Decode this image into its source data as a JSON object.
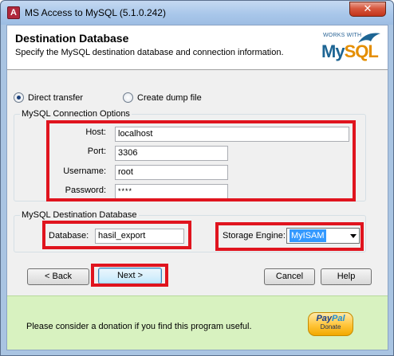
{
  "window": {
    "title": "MS Access to MySQL (5.1.0.242)",
    "close_glyph": "✕"
  },
  "header": {
    "title": "Destination Database",
    "subtitle": "Specify the MySQL destination database and connection information.",
    "logo": {
      "works_with": "WORKS WITH",
      "my": "My",
      "sql": "SQL"
    }
  },
  "transfer_mode": {
    "direct_label": "Direct transfer",
    "dump_label": "Create dump file",
    "selected": "direct"
  },
  "connection": {
    "group_label": "MySQL Connection Options",
    "host_label": "Host:",
    "host_value": "localhost",
    "port_label": "Port:",
    "port_value": "3306",
    "username_label": "Username:",
    "username_value": "root",
    "password_label": "Password:",
    "password_value": "****"
  },
  "destination": {
    "group_label": "MySQL Destination Database",
    "database_label": "Database:",
    "database_value": "hasil_export",
    "engine_label": "Storage Engine:",
    "engine_value": "MyISAM"
  },
  "buttons": {
    "back": "< Back",
    "next": "Next >",
    "cancel": "Cancel",
    "help": "Help"
  },
  "footer": {
    "donate_text": "Please consider a donation if you find this program useful.",
    "paypal_pay": "Pay",
    "paypal_pal": "Pal",
    "paypal_donate": "Donate"
  },
  "colors": {
    "highlight": "#e0141e",
    "footer_bg": "#d8f2c0",
    "selection": "#3399ff"
  },
  "icons": [
    "app-icon",
    "close-icon",
    "radio-icon",
    "dropdown-arrow-icon",
    "mysql-logo",
    "paypal-logo"
  ]
}
